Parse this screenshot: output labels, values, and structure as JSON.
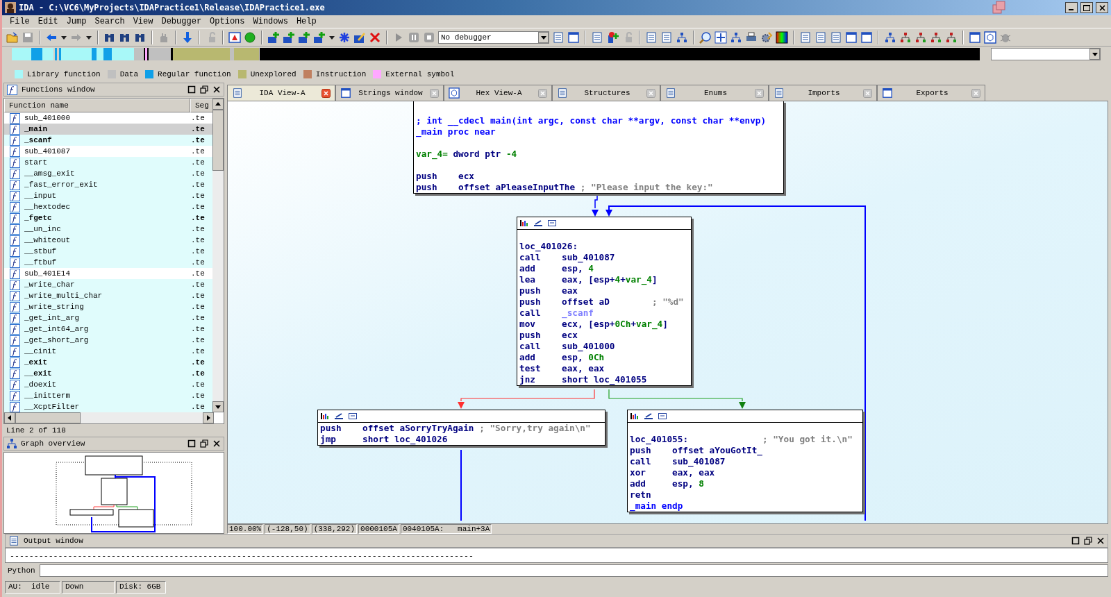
{
  "window": {
    "title": "IDA - C:\\VC6\\MyProjects\\IDAPractice1\\Release\\IDAPractice1.exe"
  },
  "menu": [
    "File",
    "Edit",
    "Jump",
    "Search",
    "View",
    "Debugger",
    "Options",
    "Windows",
    "Help"
  ],
  "toolbar": {
    "debugger": "No debugger"
  },
  "legend": [
    {
      "label": "Library function",
      "color": "#a8f8f8"
    },
    {
      "label": "Data",
      "color": "#c0c0c0"
    },
    {
      "label": "Regular function",
      "color": "#10a0e8"
    },
    {
      "label": "Unexplored",
      "color": "#b8b870"
    },
    {
      "label": "Instruction",
      "color": "#c08060"
    },
    {
      "label": "External symbol",
      "color": "#ffa8ff"
    }
  ],
  "functions_window": {
    "title": "Functions window",
    "columns": [
      "Function name",
      "Seg"
    ],
    "footer": "Line 2 of 118",
    "rows": [
      {
        "name": "sub_401000",
        "segment": ".te",
        "kind": "regular",
        "bold": false,
        "selected": false
      },
      {
        "name": "_main",
        "segment": ".te",
        "kind": "regular",
        "bold": true,
        "selected": true
      },
      {
        "name": "_scanf",
        "segment": ".te",
        "kind": "library",
        "bold": true,
        "selected": false
      },
      {
        "name": "sub_401087",
        "segment": ".te",
        "kind": "regular",
        "bold": false,
        "selected": false
      },
      {
        "name": "start",
        "segment": ".te",
        "kind": "library",
        "bold": false,
        "selected": false
      },
      {
        "name": "__amsg_exit",
        "segment": ".te",
        "kind": "library",
        "bold": false,
        "selected": false
      },
      {
        "name": "_fast_error_exit",
        "segment": ".te",
        "kind": "library",
        "bold": false,
        "selected": false
      },
      {
        "name": "__input",
        "segment": ".te",
        "kind": "library",
        "bold": false,
        "selected": false
      },
      {
        "name": "__hextodec",
        "segment": ".te",
        "kind": "library",
        "bold": false,
        "selected": false
      },
      {
        "name": "_fgetc",
        "segment": ".te",
        "kind": "library",
        "bold": true,
        "selected": false
      },
      {
        "name": "__un_inc",
        "segment": ".te",
        "kind": "library",
        "bold": false,
        "selected": false
      },
      {
        "name": "__whiteout",
        "segment": ".te",
        "kind": "library",
        "bold": false,
        "selected": false
      },
      {
        "name": "__stbuf",
        "segment": ".te",
        "kind": "library",
        "bold": false,
        "selected": false
      },
      {
        "name": "__ftbuf",
        "segment": ".te",
        "kind": "library",
        "bold": false,
        "selected": false
      },
      {
        "name": "sub_401E14",
        "segment": ".te",
        "kind": "regular",
        "bold": false,
        "selected": false
      },
      {
        "name": "_write_char",
        "segment": ".te",
        "kind": "library",
        "bold": false,
        "selected": false
      },
      {
        "name": "_write_multi_char",
        "segment": ".te",
        "kind": "library",
        "bold": false,
        "selected": false
      },
      {
        "name": "_write_string",
        "segment": ".te",
        "kind": "library",
        "bold": false,
        "selected": false
      },
      {
        "name": "_get_int_arg",
        "segment": ".te",
        "kind": "library",
        "bold": false,
        "selected": false
      },
      {
        "name": "_get_int64_arg",
        "segment": ".te",
        "kind": "library",
        "bold": false,
        "selected": false
      },
      {
        "name": "_get_short_arg",
        "segment": ".te",
        "kind": "library",
        "bold": false,
        "selected": false
      },
      {
        "name": "__cinit",
        "segment": ".te",
        "kind": "library",
        "bold": false,
        "selected": false
      },
      {
        "name": "_exit",
        "segment": ".te",
        "kind": "library",
        "bold": true,
        "selected": false
      },
      {
        "name": "__exit",
        "segment": ".te",
        "kind": "library",
        "bold": true,
        "selected": false
      },
      {
        "name": "_doexit",
        "segment": ".te",
        "kind": "library",
        "bold": false,
        "selected": false
      },
      {
        "name": "__initterm",
        "segment": ".te",
        "kind": "library",
        "bold": false,
        "selected": false
      },
      {
        "name": "__XcptFilter",
        "segment": ".te",
        "kind": "library",
        "bold": false,
        "selected": false
      }
    ]
  },
  "graph_overview": {
    "title": "Graph overview"
  },
  "tabs": [
    {
      "label": "IDA View-A",
      "selected": true
    },
    {
      "label": "Strings window",
      "selected": false
    },
    {
      "label": "Hex View-A",
      "selected": false
    },
    {
      "label": "Structures",
      "selected": false
    },
    {
      "label": "Enums",
      "selected": false
    },
    {
      "label": "Imports",
      "selected": false
    },
    {
      "label": "Exports",
      "selected": false
    }
  ],
  "graph": {
    "nodes": [
      {
        "kind": "entry",
        "lines": [
          {
            "kind": "blank"
          },
          {
            "kind": "header",
            "text": "; int __cdecl main(int argc, const char **argv, const char **envp)"
          },
          {
            "kind": "header",
            "text": "_main proc near"
          },
          {
            "kind": "blank"
          },
          {
            "kind": "vardef",
            "operand": [
              {
                "text": "var_4=",
                "kind": "variable"
              },
              {
                "text": " dword ptr "
              },
              {
                "text": "-4",
                "kind": "number"
              }
            ]
          },
          {
            "kind": "blank"
          },
          {
            "kind": "instr",
            "mnemonic": "push",
            "operand": [
              {
                "text": "ecx"
              }
            ]
          },
          {
            "kind": "instr",
            "mnemonic": "push",
            "operand": [
              {
                "text": "offset aPleaseInputThe"
              }
            ],
            "comment": "; \"Please input the key:\""
          }
        ]
      },
      {
        "kind": "block",
        "lines": [
          {
            "kind": "blank"
          },
          {
            "kind": "label",
            "text": "loc_401026:"
          },
          {
            "kind": "instr",
            "mnemonic": "call",
            "operand": [
              {
                "text": "sub_401087"
              }
            ]
          },
          {
            "kind": "instr",
            "mnemonic": "add",
            "operand": [
              {
                "text": "esp, "
              },
              {
                "text": "4",
                "kind": "number"
              }
            ]
          },
          {
            "kind": "instr",
            "mnemonic": "lea",
            "operand": [
              {
                "text": "eax, [esp+"
              },
              {
                "text": "4",
                "kind": "number"
              },
              {
                "text": "+"
              },
              {
                "text": "var_4",
                "kind": "variable"
              },
              {
                "text": "]"
              }
            ]
          },
          {
            "kind": "instr",
            "mnemonic": "push",
            "operand": [
              {
                "text": "eax"
              }
            ]
          },
          {
            "kind": "instr",
            "mnemonic": "push",
            "operand": [
              {
                "text": "offset aD"
              }
            ],
            "comment": "; \"%d\""
          },
          {
            "kind": "instr",
            "mnemonic": "call",
            "operand": [
              {
                "text": "_scanf",
                "kind": "import"
              }
            ]
          },
          {
            "kind": "instr",
            "mnemonic": "mov",
            "operand": [
              {
                "text": "ecx, [esp+"
              },
              {
                "text": "0Ch",
                "kind": "number"
              },
              {
                "text": "+"
              },
              {
                "text": "var_4",
                "kind": "variable"
              },
              {
                "text": "]"
              }
            ]
          },
          {
            "kind": "instr",
            "mnemonic": "push",
            "operand": [
              {
                "text": "ecx"
              }
            ]
          },
          {
            "kind": "instr",
            "mnemonic": "call",
            "operand": [
              {
                "text": "sub_401000"
              }
            ]
          },
          {
            "kind": "instr",
            "mnemonic": "add",
            "operand": [
              {
                "text": "esp, "
              },
              {
                "text": "0Ch",
                "kind": "number"
              }
            ]
          },
          {
            "kind": "instr",
            "mnemonic": "test",
            "operand": [
              {
                "text": "eax, eax"
              }
            ]
          },
          {
            "kind": "instr",
            "mnemonic": "jnz",
            "operand": [
              {
                "text": "short loc_401055"
              }
            ]
          }
        ]
      },
      {
        "kind": "block",
        "lines": [
          {
            "kind": "instr",
            "mnemonic": "push",
            "operand": [
              {
                "text": "offset aSorryTryAgain"
              }
            ],
            "comment": "; \"Sorry,try again\\n\""
          },
          {
            "kind": "instr",
            "mnemonic": "jmp",
            "operand": [
              {
                "text": "short loc_401026"
              }
            ]
          }
        ]
      },
      {
        "kind": "block",
        "lines": [
          {
            "kind": "blank"
          },
          {
            "kind": "label",
            "text": "loc_401055:",
            "comment": "; \"You got it.\\n\""
          },
          {
            "kind": "instr",
            "mnemonic": "push",
            "operand": [
              {
                "text": "offset aYouGotIt_"
              }
            ]
          },
          {
            "kind": "instr",
            "mnemonic": "call",
            "operand": [
              {
                "text": "sub_401087"
              }
            ]
          },
          {
            "kind": "instr",
            "mnemonic": "xor",
            "operand": [
              {
                "text": "eax, eax"
              }
            ]
          },
          {
            "kind": "instr",
            "mnemonic": "add",
            "operand": [
              {
                "text": "esp, "
              },
              {
                "text": "8",
                "kind": "number"
              }
            ]
          },
          {
            "kind": "instr",
            "mnemonic": "retn"
          },
          {
            "kind": "header",
            "text": "_main endp"
          }
        ]
      }
    ],
    "status": [
      "100.00%",
      "(-128,50)",
      "(338,292)",
      "0000105A",
      "0040105A:   main+3A"
    ]
  },
  "output_window": {
    "title": "Output window",
    "lines": [
      "------------------------------------------------------------------------------------------------"
    ]
  },
  "python": {
    "label": "Python"
  },
  "status_bar": [
    "AU:  idle",
    "Down",
    "Disk: 6GB"
  ]
}
